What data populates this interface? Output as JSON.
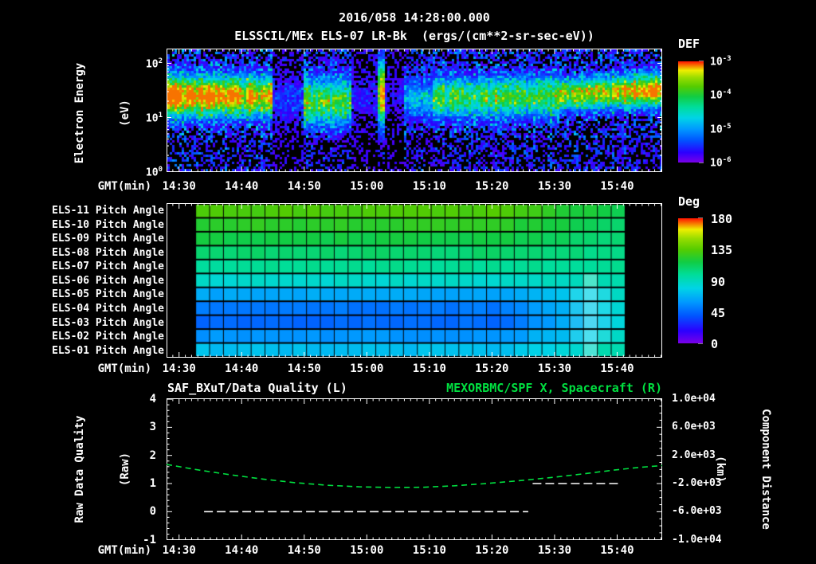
{
  "header": {
    "title_line1": "2016/058 14:28:00.000",
    "title_line2": "ELSSCIL/MEx ELS-07 LR-Bk  (ergs/(cm**2-sr-sec-eV))"
  },
  "colors": {
    "background": "#000000",
    "text": "#ffffff",
    "green_series": "#00e040",
    "rainbow_stops": [
      [
        0,
        "#7a00e6"
      ],
      [
        0.1,
        "#2b00ff"
      ],
      [
        0.22,
        "#0055ff"
      ],
      [
        0.33,
        "#0099ff"
      ],
      [
        0.44,
        "#00d4e6"
      ],
      [
        0.55,
        "#00dd99"
      ],
      [
        0.65,
        "#11cc44"
      ],
      [
        0.75,
        "#55cc00"
      ],
      [
        0.84,
        "#99dd00"
      ],
      [
        0.91,
        "#eeee00"
      ],
      [
        1,
        "#ff1100"
      ]
    ]
  },
  "time_axis": {
    "label": "GMT(min)",
    "tick_labels": [
      "14:30",
      "14:40",
      "14:50",
      "15:00",
      "15:10",
      "15:20",
      "15:30",
      "15:40"
    ],
    "first_label_offset_min": 2,
    "label_step_min": 10,
    "minor_step_min": 1,
    "span_min": 79.2,
    "start_gmt": "14:28:00"
  },
  "spectro_panel": {
    "ylabel_line1": "Electron Energy",
    "ylabel_line2": "(eV)",
    "y_tick_exponents": [
      "2",
      "1",
      "0"
    ],
    "colorbar_title": "DEF",
    "colorbar_tick_exponents": [
      "-3",
      "-4",
      "-5",
      "-6"
    ]
  },
  "pitch_panel": {
    "row_labels": [
      "ELS-11 Pitch Angle",
      "ELS-10 Pitch Angle",
      "ELS-09 Pitch Angle",
      "ELS-08 Pitch Angle",
      "ELS-07 Pitch Angle",
      "ELS-06 Pitch Angle",
      "ELS-05 Pitch Angle",
      "ELS-04 Pitch Angle",
      "ELS-03 Pitch Angle",
      "ELS-02 Pitch Angle",
      "ELS-01 Pitch Angle"
    ],
    "colorbar_title": "Deg",
    "colorbar_tick_labels": [
      "180",
      "135",
      "90",
      "45",
      "0"
    ]
  },
  "quality_panel": {
    "title_left": "SAF_BXuT/Data Quality (L)",
    "title_right": "MEXORBMC/SPF X, Spacecraft (R)",
    "ylabel_left_line1": "Raw Data Quality",
    "ylabel_left_line2": "(Raw)",
    "ylabel_right_line1": "Component Distance",
    "ylabel_right_line2": "(km)",
    "y_tick_labels_left": [
      "4",
      "3",
      "2",
      "1",
      "0",
      "-1"
    ],
    "y_tick_labels_right": [
      "1.0e+04",
      "6.0e+03",
      "2.0e+03",
      "-2.0e+03",
      "-6.0e+03",
      "-1.0e+04"
    ]
  },
  "chart_data": [
    {
      "type": "heatmap",
      "name": "electron-energy-spectrogram",
      "title": "ELSSCIL/MEx ELS-07 LR-Bk  (ergs/(cm**2-sr-sec-eV))",
      "xlabel": "GMT(min)",
      "ylabel": "Electron Energy (eV)",
      "x_range_gmt": [
        "14:28",
        "15:47"
      ],
      "y_scale": "log",
      "y_range_ev": [
        1,
        180
      ],
      "colorbar": {
        "title": "DEF",
        "scale": "log",
        "tick_values": [
          0.001,
          0.0001,
          1e-05,
          1e-06
        ]
      },
      "features": [
        {
          "t_min": [
            0,
            10.3
          ],
          "desc": "intense flux band ~8-50 eV, yellow core near 20-30 eV"
        },
        {
          "t_min": [
            10.3,
            16.6
          ],
          "desc": "band continues, green, slightly weaker"
        },
        {
          "t_min": [
            16.6,
            21.9
          ],
          "desc": "data gap / very low flux, sparse blue specks"
        },
        {
          "t_min": [
            21.9,
            29.6
          ],
          "desc": "moderate cyan-green band ~5-40 eV"
        },
        {
          "t_min": [
            29.6,
            33.5
          ],
          "desc": "gap, mostly black"
        },
        {
          "t_min": [
            33.5,
            34.8
          ],
          "desc": "narrow bright cyan column spanning wide energy range"
        },
        {
          "t_min": [
            34.8,
            42.3
          ],
          "desc": "very low flux, sparse blue"
        },
        {
          "t_min": [
            42.3,
            62.6
          ],
          "desc": "moderate cyan-green band ~8-40 eV with vertical striations"
        },
        {
          "t_min": [
            62.6,
            79.2
          ],
          "desc": "band intensifies toward yellow at ~20-40 eV through end"
        }
      ],
      "render": {
        "seed": 20160581,
        "cell": 3,
        "segments": [
          [
            0.0,
            0.132,
            1.0,
            0.92,
            0.386,
            0.386,
            0.105,
            1.0
          ],
          [
            0.132,
            0.21,
            0.9,
            0.8,
            0.386,
            0.386,
            0.105,
            1.0
          ],
          [
            0.21,
            0.277,
            0.12,
            0.12,
            0.41,
            0.41,
            0.12,
            0.45
          ],
          [
            0.277,
            0.374,
            0.62,
            0.55,
            0.429,
            0.429,
            0.124,
            0.8
          ],
          [
            0.374,
            0.423,
            0.08,
            0.08,
            0.41,
            0.41,
            0.105,
            0.4
          ],
          [
            0.423,
            0.44,
            0.8,
            0.8,
            0.359,
            0.359,
            0.17,
            0.6
          ],
          [
            0.44,
            0.479,
            0.06,
            0.06,
            0.386,
            0.386,
            0.105,
            0.35
          ],
          [
            0.479,
            0.535,
            0.3,
            0.35,
            0.41,
            0.41,
            0.105,
            0.8
          ],
          [
            0.535,
            0.794,
            0.55,
            0.6,
            0.4,
            0.386,
            0.108,
            0.9
          ],
          [
            0.794,
            1.001,
            0.7,
            1.0,
            0.373,
            0.333,
            0.085,
            0.95
          ]
        ]
      }
    },
    {
      "type": "heatmap",
      "name": "pitch-angle-panel",
      "rows_top_to_bottom": [
        "ELS-11",
        "ELS-10",
        "ELS-09",
        "ELS-08",
        "ELS-07",
        "ELS-06",
        "ELS-05",
        "ELS-04",
        "ELS-03",
        "ELS-02",
        "ELS-01"
      ],
      "units": "deg",
      "colorbar": {
        "title": "Deg",
        "ticks": [
          180,
          135,
          90,
          45,
          0
        ]
      },
      "data_t_min": [
        4.6,
        73.2
      ],
      "columns": 31,
      "values_start_deg": [
        133,
        124,
        117,
        108,
        100,
        86,
        64,
        50,
        46,
        58,
        72
      ],
      "values_end_deg": [
        112,
        108,
        105,
        102,
        99,
        93,
        88,
        84,
        82,
        88,
        96
      ],
      "converge_start_frac": 0.72
    },
    {
      "type": "line",
      "name": "quality-and-distance",
      "title_left": "SAF_BXuT/Data Quality (L)",
      "title_right": "MEXORBMC/SPF X, Spacecraft (R)",
      "xlabel": "GMT(min)",
      "ylabel_left": "Raw Data Quality (Raw)",
      "ylabel_right": "Component Distance (km)",
      "ylim_left": [
        -1,
        4
      ],
      "ylim_right": [
        -10000,
        10000
      ],
      "legend_position": "none",
      "grid": false,
      "series": [
        {
          "name": "MEXORBMC/SPF X Spacecraft (right axis)",
          "color": "#00e040",
          "style": "dashed",
          "points_t_min_vs_left_units": [
            [
              0,
              1.68
            ],
            [
              5.2,
              1.48
            ],
            [
              10.3,
              1.31
            ],
            [
              15.4,
              1.16
            ],
            [
              20.5,
              1.03
            ],
            [
              25.6,
              0.94
            ],
            [
              30.7,
              0.885
            ],
            [
              35.8,
              0.862
            ],
            [
              40.9,
              0.868
            ],
            [
              46.0,
              0.92
            ],
            [
              51.1,
              1.0
            ],
            [
              56.2,
              1.1
            ],
            [
              61.3,
              1.21
            ],
            [
              66.4,
              1.34
            ],
            [
              71.5,
              1.48
            ],
            [
              75.3,
              1.57
            ],
            [
              79.2,
              1.64
            ]
          ]
        },
        {
          "name": "SAF_BXuT Data Quality segment 1",
          "color": "#ffffff",
          "style": "dashed",
          "left_value": 0,
          "t_min": [
            6.0,
            57.8
          ]
        },
        {
          "name": "SAF_BXuT Data Quality segment 2",
          "color": "#ffffff",
          "style": "dashed",
          "left_value": 1,
          "t_min": [
            58.5,
            72.7
          ]
        }
      ]
    }
  ]
}
